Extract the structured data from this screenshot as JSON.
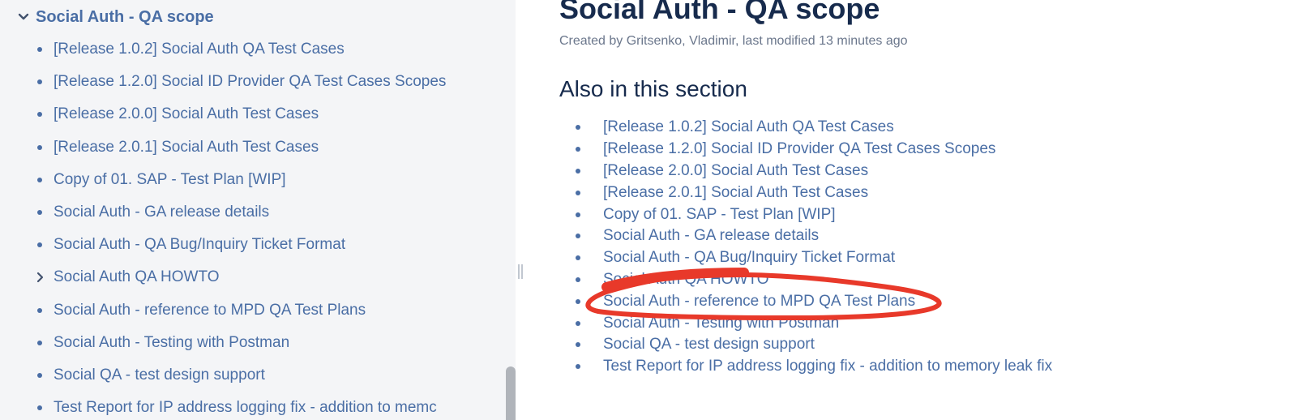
{
  "sidebar": {
    "parent": {
      "label": "Social Auth - QA scope",
      "icon": "chevron-down-icon"
    },
    "items": [
      {
        "label": "[Release 1.0.2] Social Auth QA Test Cases",
        "icon": "bullet"
      },
      {
        "label": "[Release 1.2.0] Social ID Provider QA Test Cases Scopes",
        "icon": "bullet"
      },
      {
        "label": "[Release 2.0.0] Social Auth Test Cases",
        "icon": "bullet"
      },
      {
        "label": "[Release 2.0.1] Social Auth Test Cases",
        "icon": "bullet"
      },
      {
        "label": "Copy of 01. SAP - Test Plan [WIP]",
        "icon": "bullet"
      },
      {
        "label": "Social Auth - GA release details",
        "icon": "bullet"
      },
      {
        "label": "Social Auth - QA Bug/Inquiry Ticket Format",
        "icon": "bullet"
      },
      {
        "label": "Social Auth QA HOWTO",
        "icon": "chevron-right-icon"
      },
      {
        "label": "Social Auth - reference to MPD QA Test Plans",
        "icon": "bullet"
      },
      {
        "label": "Social Auth - Testing with Postman",
        "icon": "bullet"
      },
      {
        "label": "Social QA - test design support",
        "icon": "bullet"
      },
      {
        "label": "Test Report for IP address logging fix - addition to memc",
        "icon": "bullet"
      }
    ]
  },
  "main": {
    "title": "Social Auth - QA scope",
    "byline": "Created by Gritsenko, Vladimir, last modified 13 minutes ago",
    "section_heading": "Also in this section",
    "section_links": [
      "[Release 1.0.2] Social Auth QA Test Cases",
      "[Release 1.2.0] Social ID Provider QA Test Cases Scopes",
      "[Release 2.0.0] Social Auth Test Cases",
      "[Release 2.0.1] Social Auth Test Cases",
      "Copy of 01. SAP - Test Plan [WIP]",
      "Social Auth - GA release details",
      "Social Auth - QA Bug/Inquiry Ticket Format",
      "Social Auth QA HOWTO",
      "Social Auth - reference to MPD QA Test Plans",
      "Social Auth - Testing with Postman",
      "Social QA - test design support",
      "Test Report for IP address logging fix - addition to memory leak fix"
    ]
  },
  "colors": {
    "link": "#4a6ea5",
    "heading": "#172b4d",
    "sidebar_bg": "#f4f5f7",
    "annotation": "#e8392a"
  }
}
